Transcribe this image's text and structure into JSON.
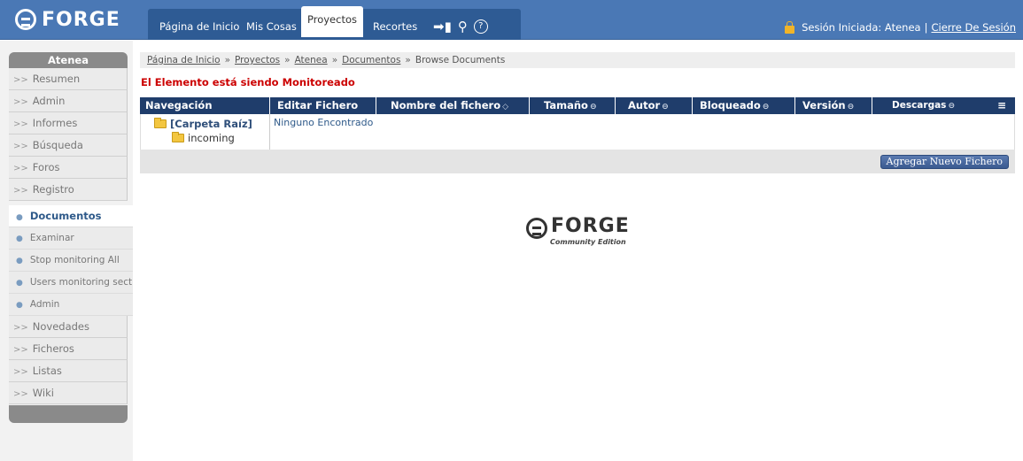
{
  "brand": {
    "name": "FORGE",
    "edition": "Community Edition"
  },
  "nav": {
    "tabs": [
      {
        "label": "Página de Inicio"
      },
      {
        "label": "Mis Cosas"
      },
      {
        "label": "Proyectos",
        "active": true
      },
      {
        "label": "Recortes"
      }
    ],
    "icons": [
      "login-arrow-icon",
      "search-user-icon",
      "help-icon"
    ]
  },
  "session": {
    "label": "Sesión Iniciada: Atenea",
    "separator": "|",
    "logout": "Cierre De Sesión"
  },
  "sidebar": {
    "title": "Atenea",
    "items": [
      {
        "label": "Resumen"
      },
      {
        "label": "Admin"
      },
      {
        "label": "Informes"
      },
      {
        "label": "Búsqueda"
      },
      {
        "label": "Foros"
      },
      {
        "label": "Registro"
      }
    ],
    "sub_items": [
      {
        "label": "Documentos",
        "current": true
      },
      {
        "label": "Examinar"
      },
      {
        "label": "Stop monitoring All"
      },
      {
        "label": "Users monitoring section"
      },
      {
        "label": "Admin"
      }
    ],
    "items_after": [
      {
        "label": "Novedades"
      },
      {
        "label": "Ficheros"
      },
      {
        "label": "Listas"
      },
      {
        "label": "Wiki"
      }
    ]
  },
  "breadcrumb": {
    "items": [
      "Página de Inicio",
      "Proyectos",
      "Atenea",
      "Documentos"
    ],
    "current": "Browse Documents",
    "separator": "»"
  },
  "monitor_message": "El Elemento está siendo Monitoreado",
  "table": {
    "columns": [
      {
        "label": "Navegación",
        "sortable": false
      },
      {
        "label": "Editar Fichero",
        "sortable": false
      },
      {
        "label": "Nombre del fichero",
        "sortable": true
      },
      {
        "label": "Tamaño",
        "sortable": true
      },
      {
        "label": "Autor",
        "sortable": true
      },
      {
        "label": "Bloqueado",
        "sortable": true
      },
      {
        "label": "Versión",
        "sortable": true
      },
      {
        "label": "Descargas",
        "sortable": true
      }
    ],
    "root_folder": "[Carpeta Raíz]",
    "subfolder": "incoming",
    "empty_message": "Ninguno Encontrado",
    "add_button": "Agregar Nuevo Fichero"
  }
}
